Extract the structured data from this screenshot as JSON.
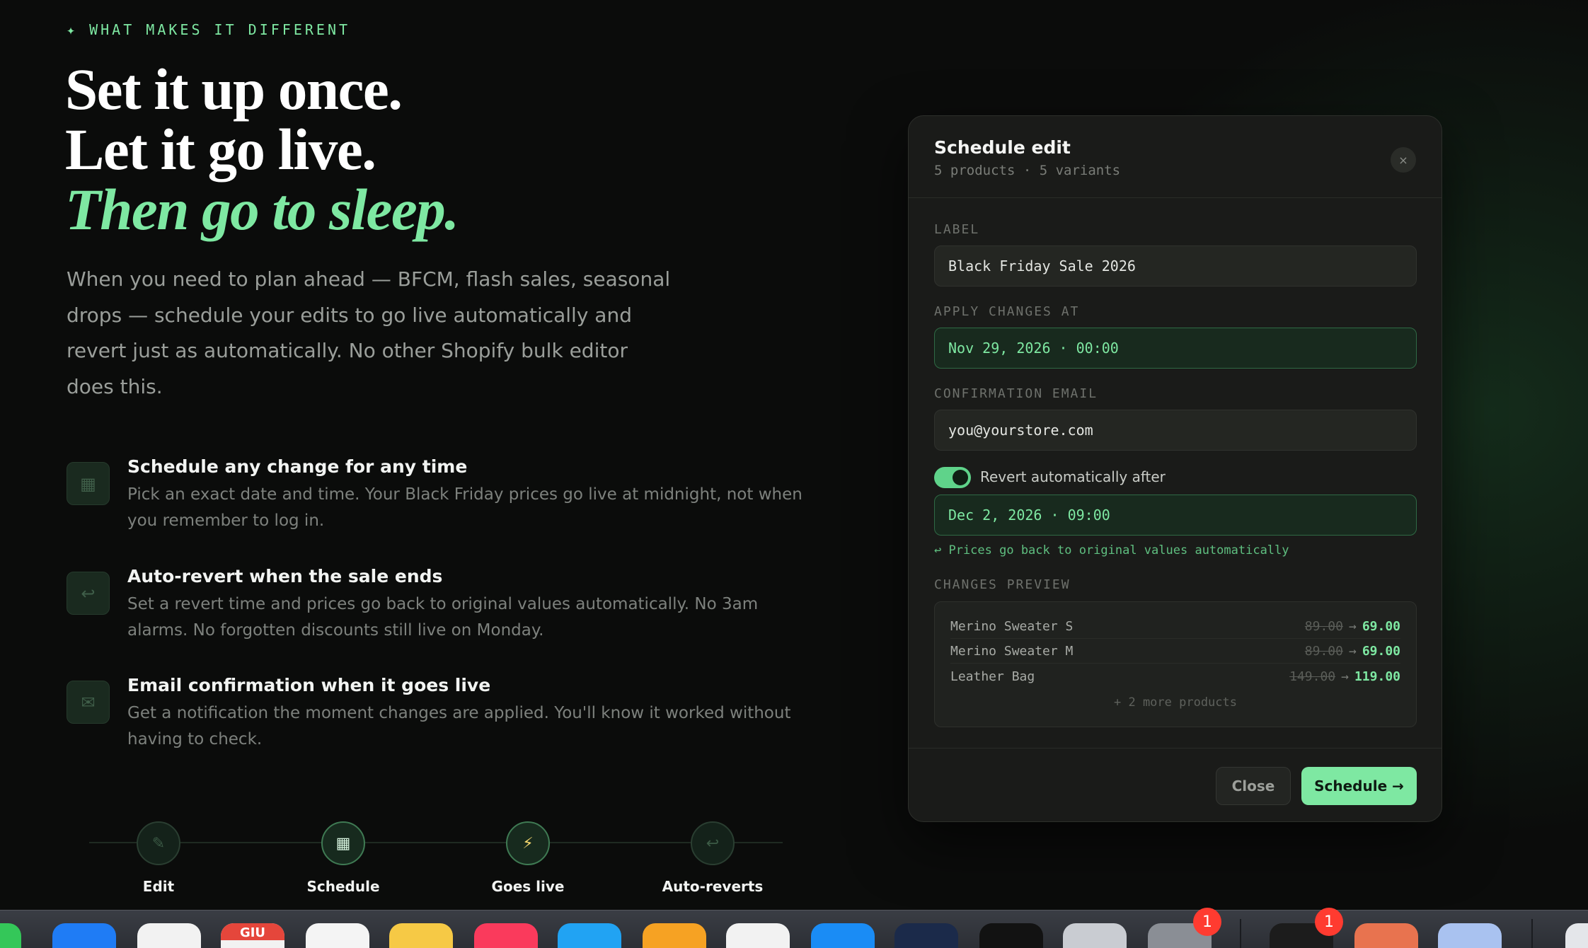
{
  "eyebrow": "✦ WHAT MAKES IT DIFFERENT",
  "headline": {
    "line1": "Set it up once.",
    "line2": "Let it go live.",
    "line3": "Then go to sleep."
  },
  "lead": "When you need to plan ahead — BFCM, flash sales, seasonal drops — schedule your edits to go live automatically and revert just as automatically. No other Shopify bulk editor does this.",
  "features": [
    {
      "icon": "calendar-icon",
      "glyph": "▦",
      "title": "Schedule any change for any time",
      "desc": "Pick an exact date and time. Your Black Friday prices go live at midnight, not when you remember to log in."
    },
    {
      "icon": "revert-icon",
      "glyph": "↩",
      "title": "Auto-revert when the sale ends",
      "desc": "Set a revert time and prices go back to original values automatically. No 3am alarms. No forgotten discounts still live on Monday."
    },
    {
      "icon": "mail-icon",
      "glyph": "✉",
      "title": "Email confirmation when it goes live",
      "desc": "Get a notification the moment changes are applied. You'll know it worked without having to check."
    }
  ],
  "timeline": [
    {
      "label": "Edit",
      "icon": "edit-icon",
      "glyph": "✎"
    },
    {
      "label": "Schedule",
      "icon": "calendar-icon",
      "glyph": "▦"
    },
    {
      "label": "Goes live",
      "icon": "lightning-icon",
      "glyph": "⚡"
    },
    {
      "label": "Auto-reverts",
      "icon": "revert-icon",
      "glyph": "↩"
    }
  ],
  "modal": {
    "title": "Schedule edit",
    "subtitle": "5 products · 5 variants",
    "close_icon": "×",
    "label_heading": "LABEL",
    "label_value": "Black Friday Sale 2026",
    "apply_heading": "APPLY CHANGES AT",
    "apply_value": "Nov 29, 2026 · 00:00",
    "email_heading": "CONFIRMATION EMAIL",
    "email_value": "you@yourstore.com",
    "revert_toggle_label": "Revert automatically after",
    "revert_toggle_on": true,
    "revert_value": "Dec 2, 2026 · 09:00",
    "revert_hint": "↩ Prices go back to original values automatically",
    "preview_heading": "CHANGES PREVIEW",
    "preview_rows": [
      {
        "name": "Merino Sweater S",
        "old": "89.00",
        "new": "69.00"
      },
      {
        "name": "Merino Sweater M",
        "old": "89.00",
        "new": "69.00"
      },
      {
        "name": "Leather Bag",
        "old": "149.00",
        "new": "119.00"
      }
    ],
    "preview_more": "+ 2 more products",
    "close_button": "Close",
    "schedule_button": "Schedule →"
  },
  "dock": {
    "calendar_month": "GIU",
    "badges": [
      "1",
      "1"
    ]
  },
  "colors": {
    "accent": "#7ee8a2",
    "background": "#0b0c0b",
    "modal": "#1a1b19"
  }
}
